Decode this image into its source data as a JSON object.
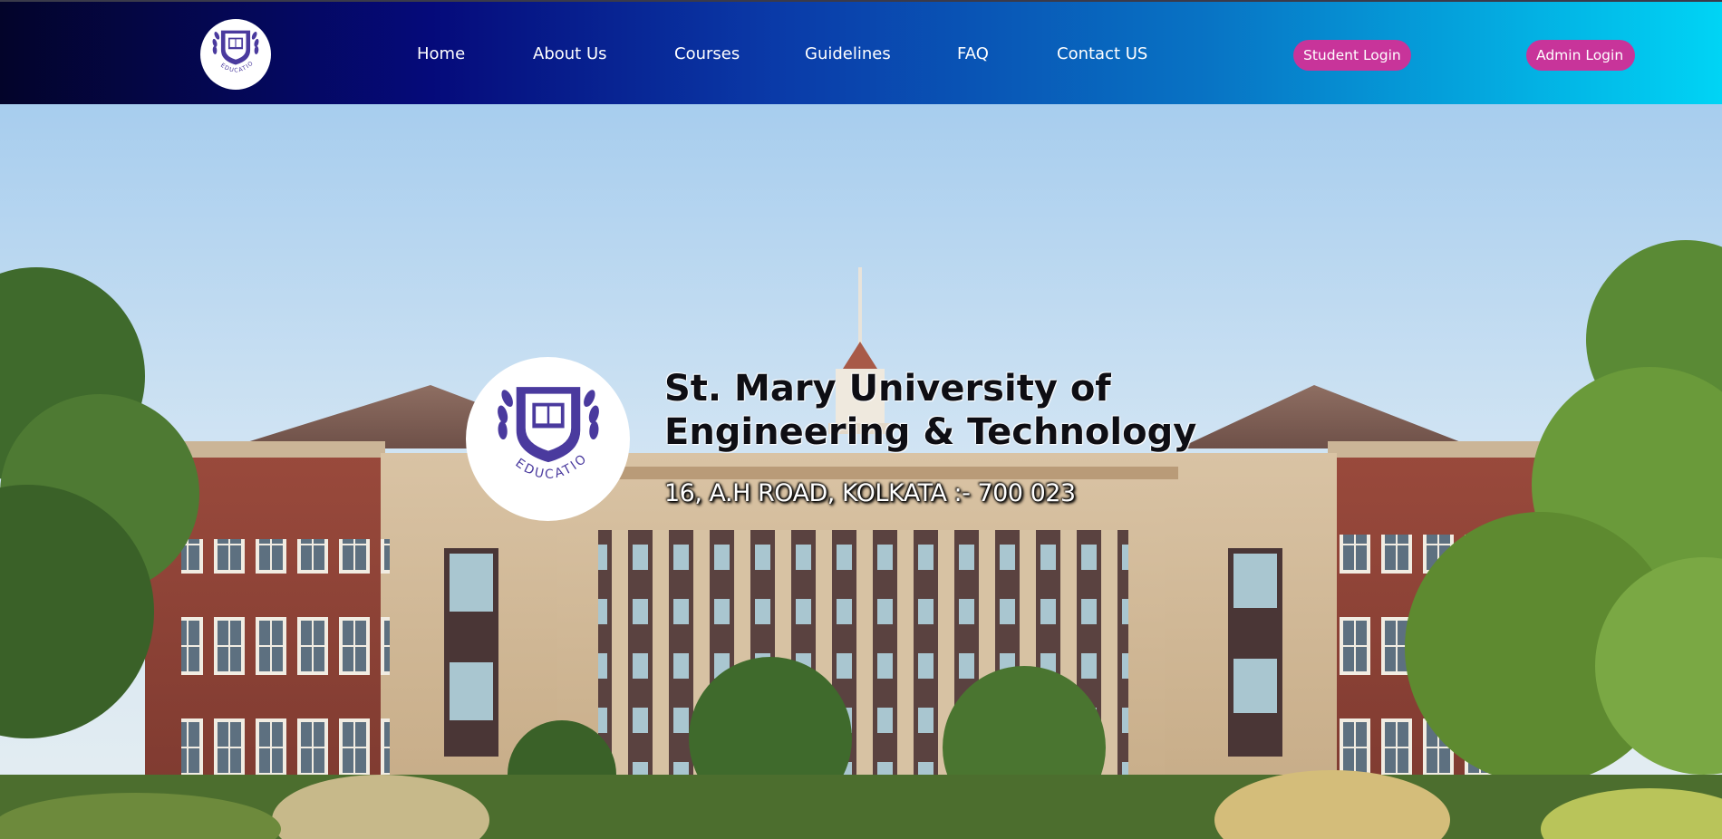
{
  "navbar": {
    "logo_icon": "education-crest-icon",
    "links": [
      "Home",
      "About Us",
      "Courses",
      "Guidelines",
      "FAQ",
      "Contact US"
    ],
    "student_login": "Student Login",
    "admin_login": "Admin Login",
    "button_color": "#c8349a",
    "gradient_start": "#03042a",
    "gradient_end": "#00d4f5"
  },
  "hero": {
    "logo_icon": "education-crest-icon",
    "logo_text": "EDUCATION",
    "title": "St. Mary University of Engineering & Technology",
    "address": "16, A.H ROAD, KOLKATA :- 700 023",
    "background": "campus-building-photo"
  },
  "crest_color": "#4a3a9e"
}
